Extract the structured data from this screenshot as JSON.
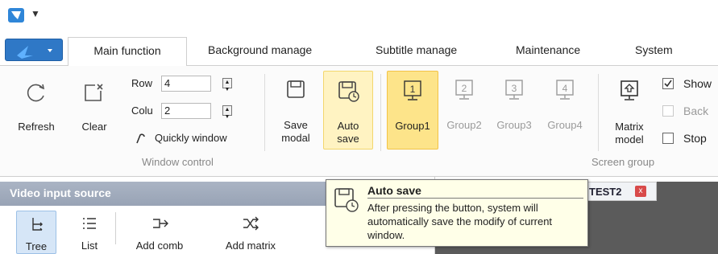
{
  "title_bar": {
    "quick_access": "▼"
  },
  "tabs": [
    "Main function",
    "Background manage",
    "Subtitle manage",
    "Maintenance",
    "System"
  ],
  "ribbon": {
    "refresh": "Refresh",
    "clear": "Clear",
    "row_label": "Row",
    "row_value": "4",
    "col_label": "Colu",
    "col_value": "2",
    "quick_window": "Quickly window",
    "group_window": "Window control",
    "save_modal_1": "Save",
    "save_modal_2": "modal",
    "auto_save_1": "Auto",
    "auto_save_2": "save",
    "groups": [
      "Group1",
      "Group2",
      "Group3",
      "Group4"
    ],
    "group_icons": [
      "1",
      "2",
      "3",
      "4"
    ],
    "matrix_1": "Matrix",
    "matrix_2": "model",
    "group_screen": "Screen group",
    "show": "Show",
    "back": "Back",
    "stop": "Stop"
  },
  "left_pane": {
    "header": "Video input source",
    "tree": "Tree",
    "list": "List",
    "add_comb": "Add comb",
    "add_matrix": "Add matrix"
  },
  "doc_tab": {
    "label": "TEST2",
    "close": "x"
  },
  "tooltip": {
    "title": "Auto save",
    "body": "After pressing the button, system will automatically save the modify of  current window."
  }
}
